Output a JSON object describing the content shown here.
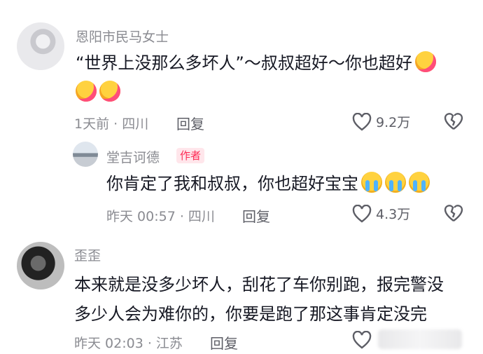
{
  "comments": [
    {
      "username": "恩阳市民马女士",
      "text_line1": "“世界上没那么多坏人”～叔叔超好～你也超好",
      "meta": "1天前 · 四川",
      "reply_label": "回复",
      "likes": "9.2万"
    },
    {
      "username": "堂吉诃德",
      "badge": "作者",
      "text_line1": "你肯定了我和叔叔，你也超好宝宝",
      "meta": "昨天 00:57 · 四川",
      "reply_label": "回复",
      "likes": "4.3万"
    },
    {
      "username": "歪歪",
      "text_line1": "本来就是没多少坏人，刮花了车你别跑，报完警没",
      "text_line2": "多少人会为难你的，你要是跑了那这事肯定没完",
      "meta": "昨天 02:03 · 江苏",
      "reply_label": "回复"
    }
  ],
  "icons": {
    "like": "heart-outline-icon",
    "dislike": "broken-heart-icon",
    "hug_emoji": "hugging-face-emoji",
    "cry_emoji": "crying-face-emoji"
  },
  "colors": {
    "author_badge": "#fe2c55",
    "muted_text": "#8a8b91"
  }
}
